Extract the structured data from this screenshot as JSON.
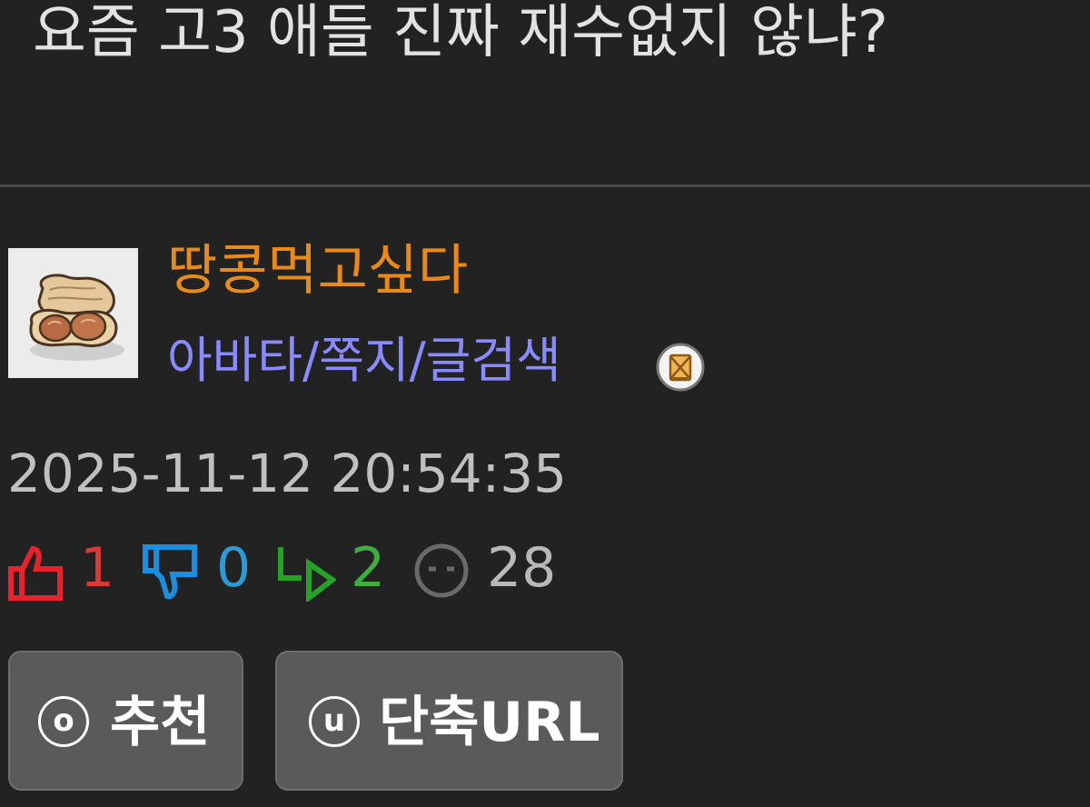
{
  "post": {
    "title": "요즘 고3 애들 진짜 재수없지 않냐?"
  },
  "author": {
    "name": "땅콩먹고싶다",
    "links_text": "아바타/쪽지/글검색",
    "avatar_icon": "peanut-avatar-icon",
    "badge_icon": "envelope-badge-icon"
  },
  "meta": {
    "datetime": "2025-11-12 20:54:35"
  },
  "stats": {
    "upvotes": "1",
    "downvotes": "0",
    "replies": "2",
    "views": "28",
    "colors": {
      "upvote": "#d83a3a",
      "downvote": "#2c9bd6",
      "reply": "#3fae3f",
      "views": "#b8b8b8"
    }
  },
  "actions": {
    "recommend": {
      "key": "o",
      "label": "추천"
    },
    "short_url": {
      "key": "u",
      "label": "단축URL"
    }
  }
}
